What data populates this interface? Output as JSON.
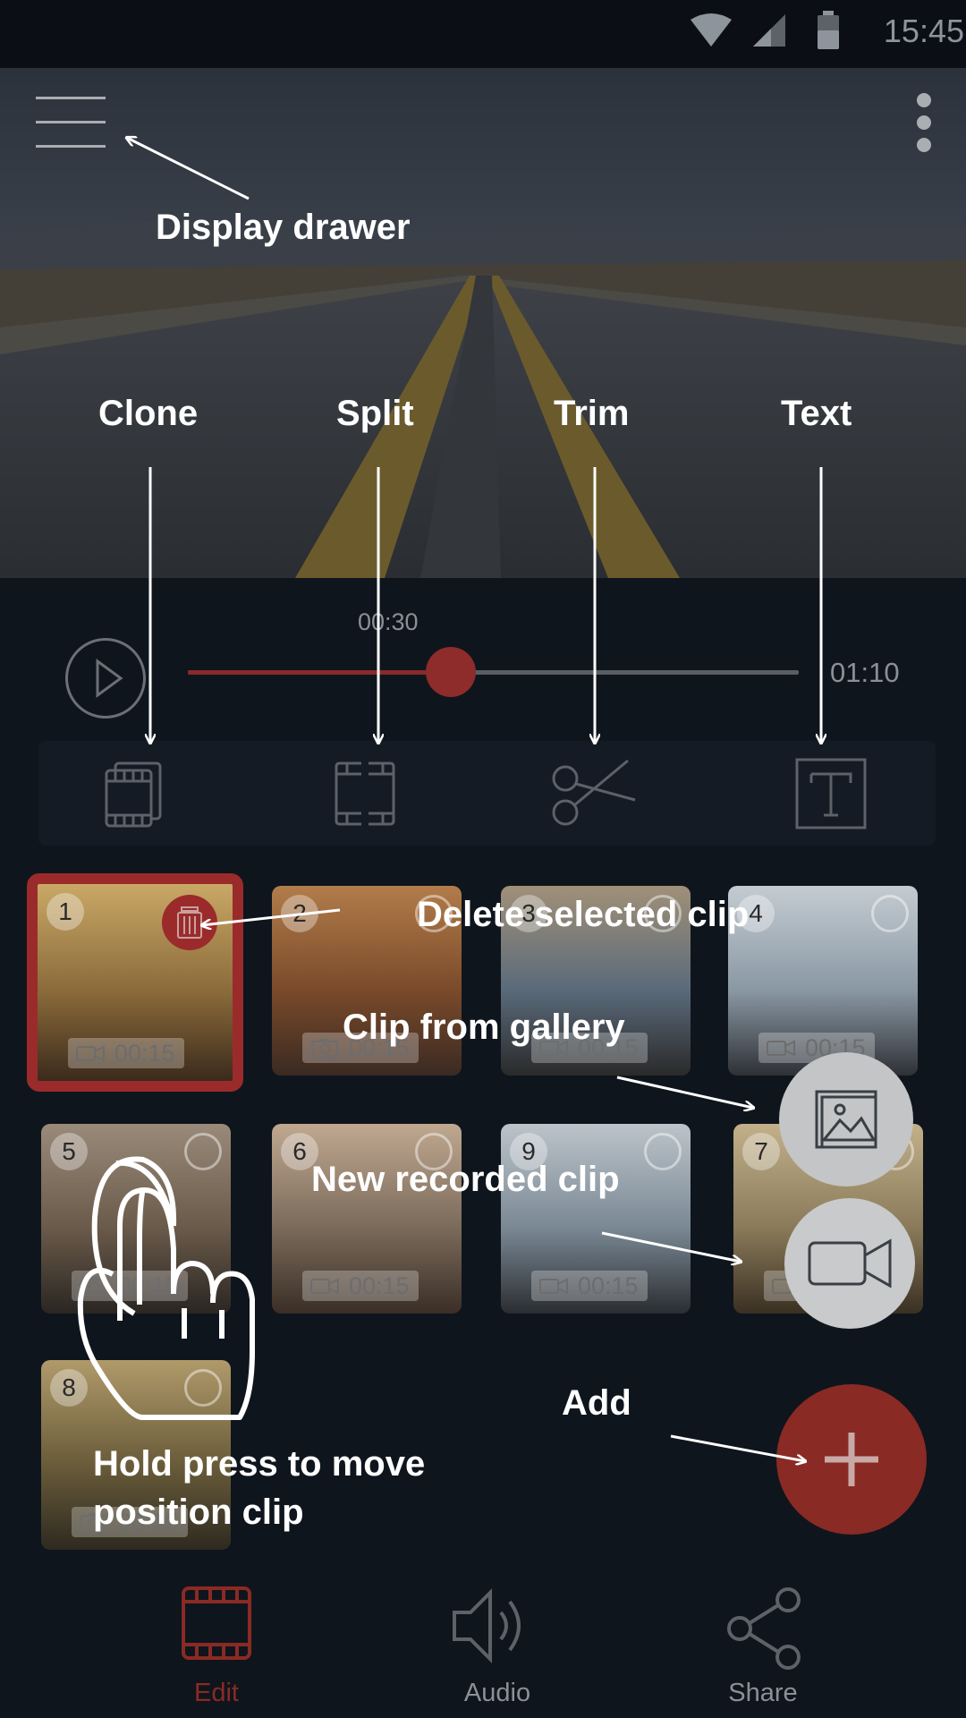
{
  "status_bar": {
    "time": "15:45",
    "icons": [
      "wifi-icon",
      "signal-icon",
      "battery-icon"
    ]
  },
  "player": {
    "current_time": "00:30",
    "total_time": "01:10",
    "progress": 0.43
  },
  "toolbar": {
    "tools": [
      "clone-icon",
      "split-icon",
      "trim-icon",
      "text-icon"
    ]
  },
  "clips": [
    {
      "number": "1",
      "duration": "00:15",
      "kind": "video",
      "selected": true
    },
    {
      "number": "2",
      "duration": "00:15",
      "kind": "photo"
    },
    {
      "number": "3",
      "duration": "00:15",
      "kind": "video"
    },
    {
      "number": "4",
      "duration": "00:15",
      "kind": "video"
    },
    {
      "number": "5",
      "duration": "00:15",
      "kind": "photo"
    },
    {
      "number": "6",
      "duration": "00:15",
      "kind": "video"
    },
    {
      "number": "9",
      "duration": "00:15",
      "kind": "video"
    },
    {
      "number": "7",
      "duration": "00:15",
      "kind": "video"
    },
    {
      "number": "8",
      "duration": "00:15",
      "kind": "photo"
    }
  ],
  "bottom_nav": {
    "edit": "Edit",
    "audio": "Audio",
    "share": "Share",
    "active_color": "#8a2a24",
    "inactive_color": "#8b9096"
  },
  "annotations": {
    "display_drawer": "Display drawer",
    "clone": "Clone",
    "split": "Split",
    "trim": "Trim",
    "text": "Text",
    "delete_clip": "Delete selected clip",
    "clip_from_gallery": "Clip from gallery",
    "new_recorded_clip": "New recorded clip",
    "add": "Add",
    "hold_press_line1": "Hold press to move",
    "hold_press_line2": "position clip"
  }
}
